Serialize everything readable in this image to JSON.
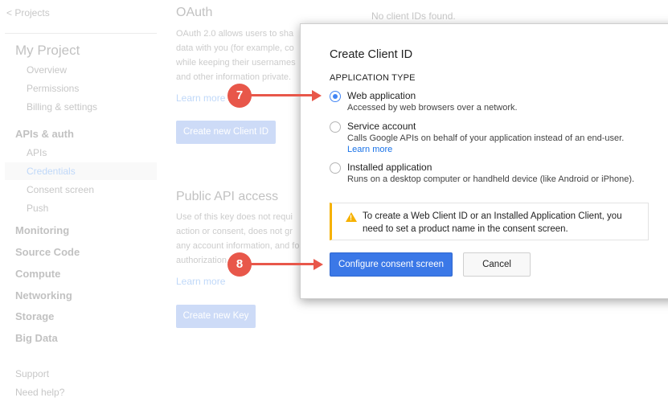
{
  "nav": {
    "back_label": "< Projects"
  },
  "sidebar": {
    "project": "My Project",
    "project_items": [
      "Overview",
      "Permissions",
      "Billing & settings"
    ],
    "apis_heading": "APIs & auth",
    "apis_items": [
      "APIs",
      "Credentials",
      "Consent screen",
      "Push"
    ],
    "sections": [
      "Monitoring",
      "Source Code",
      "Compute",
      "Networking",
      "Storage",
      "Big Data"
    ],
    "footer": [
      "Support",
      "Need help?"
    ]
  },
  "main": {
    "oauth_title": "OAuth",
    "oauth_desc": "OAuth 2.0 allows users to sha data with you (for example, co while keeping their usernames and other information private.",
    "oauth_learn_more": "Learn more",
    "create_client_button": "Create new Client ID",
    "no_client_ids": "No client IDs found.",
    "public_title": "Public API access",
    "public_desc": "Use of this key does not requi action or consent, does not gr any account information, and for authorization.",
    "public_learn_more": "Learn more",
    "create_key_button": "Create new Key"
  },
  "dialog": {
    "title": "Create Client ID",
    "section_label": "APPLICATION TYPE",
    "options": [
      {
        "label": "Web application",
        "description": "Accessed by web browsers over a network.",
        "checked": true
      },
      {
        "label": "Service account",
        "description": "Calls Google APIs on behalf of your application instead of an end-user.",
        "link": "Learn more",
        "checked": false
      },
      {
        "label": "Installed application",
        "description": "Runs on a desktop computer or handheld device (like Android or iPhone).",
        "checked": false
      }
    ],
    "warning": "To create a Web Client ID or an Installed Application Client, you need to set a product name in the consent screen.",
    "primary_button": "Configure consent screen",
    "cancel_button": "Cancel"
  },
  "callouts": {
    "step_a": "7",
    "step_b": "8"
  },
  "colors": {
    "accent": "#4285f4",
    "callout": "#e8574a",
    "warning": "#f6b100"
  }
}
